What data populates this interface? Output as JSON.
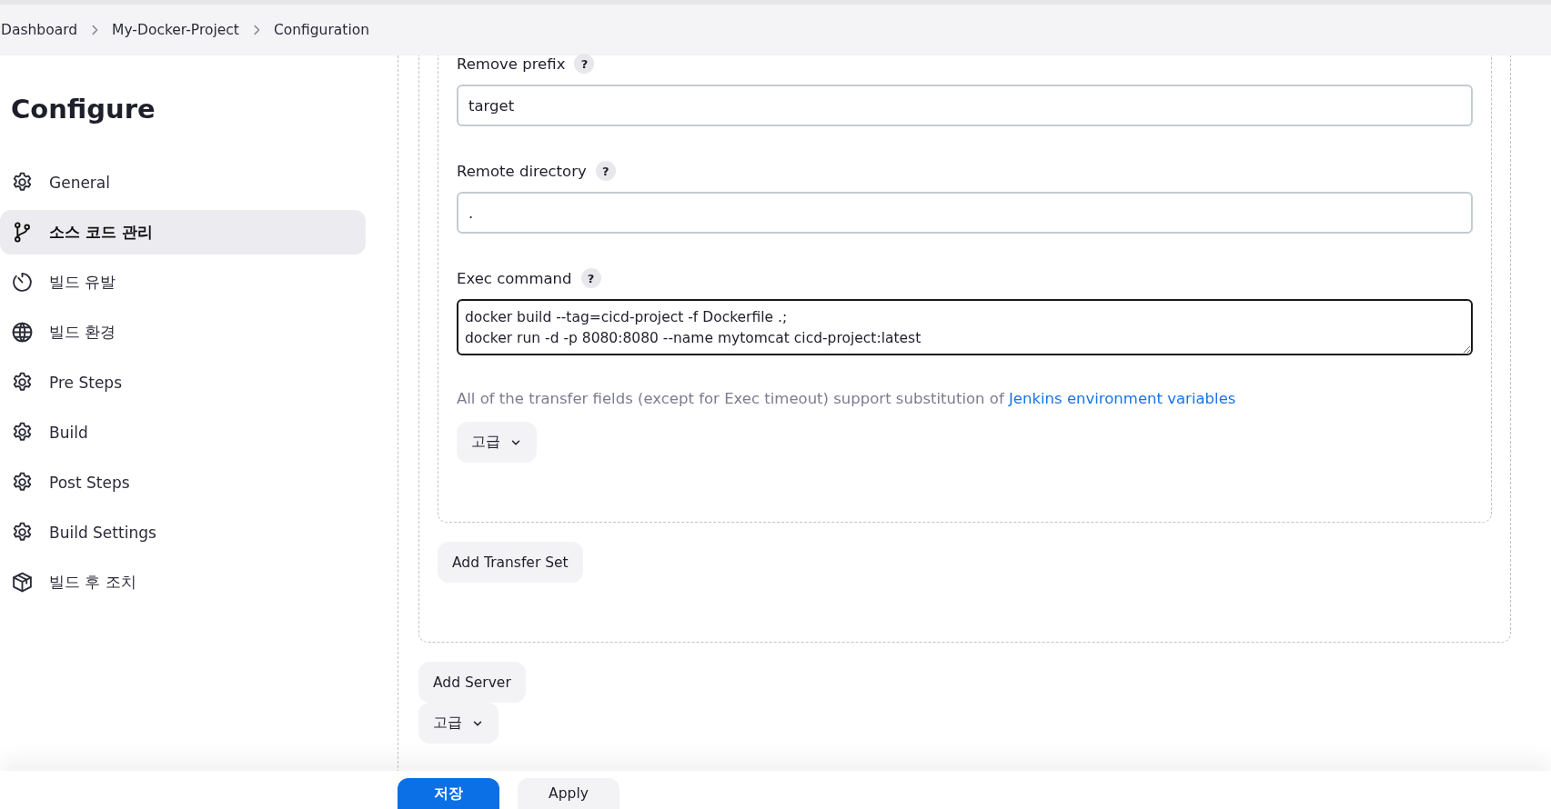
{
  "breadcrumbs": [
    {
      "label": "Dashboard"
    },
    {
      "label": "My-Docker-Project"
    },
    {
      "label": "Configuration"
    }
  ],
  "sidebar": {
    "title": "Configure",
    "items": [
      {
        "label": "General",
        "selected": false
      },
      {
        "label": "소스 코드 관리",
        "selected": true
      },
      {
        "label": "빌드 유발",
        "selected": false
      },
      {
        "label": "빌드 환경",
        "selected": false
      },
      {
        "label": "Pre Steps",
        "selected": false
      },
      {
        "label": "Build",
        "selected": false
      },
      {
        "label": "Post Steps",
        "selected": false
      },
      {
        "label": "Build Settings",
        "selected": false
      },
      {
        "label": "빌드 후 조치",
        "selected": false
      }
    ]
  },
  "transfer_set": {
    "fields": [
      {
        "kind": "input",
        "label": "Remove prefix",
        "help": "?",
        "value": "target",
        "focused": false
      },
      {
        "kind": "input",
        "label": "Remote directory",
        "help": "?",
        "value": ".",
        "focused": false
      },
      {
        "kind": "textarea",
        "label": "Exec command",
        "help": "?",
        "value": "docker build --tag=cicd-project -f Dockerfile .;\ndocker run -d -p 8080:8080 --name mytomcat cicd-project:latest",
        "focused": true
      }
    ],
    "hint": "All of the transfer fields (except for Exec timeout) support substitution of",
    "hint_link": "Jenkins environment variables",
    "advanced_button": "고급"
  },
  "add_transfer_set_button": "Add Transfer Set",
  "add_server_button": "Add Server",
  "advanced_button": "고급",
  "footer": {
    "buttons": [
      {
        "label": "저장",
        "kind": "primary"
      },
      {
        "label": "Apply",
        "kind": "secondary"
      }
    ]
  }
}
